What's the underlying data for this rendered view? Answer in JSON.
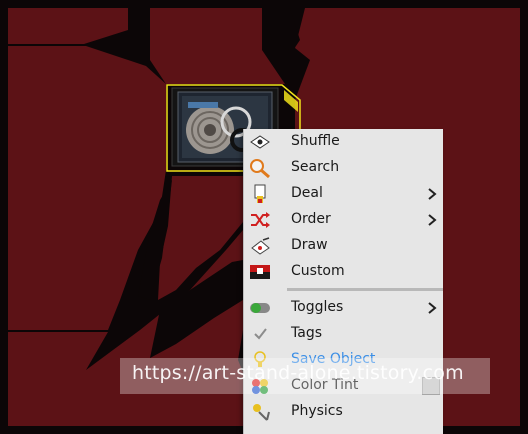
{
  "context_menu": {
    "items": [
      {
        "label": "Shuffle",
        "icon": "shuffle-card-icon",
        "has_submenu": false
      },
      {
        "label": "Search",
        "icon": "magnifier-icon",
        "has_submenu": false
      },
      {
        "label": "Deal",
        "icon": "deal-hand-icon",
        "has_submenu": true
      },
      {
        "label": "Order",
        "icon": "shuffle-arrows-icon",
        "has_submenu": true
      },
      {
        "label": "Draw",
        "icon": "draw-card-icon",
        "has_submenu": false
      },
      {
        "label": "Custom",
        "icon": "custom-card-icon",
        "has_submenu": false
      },
      {
        "label": "Toggles",
        "icon": "toggle-switch-icon",
        "has_submenu": true
      },
      {
        "label": "Tags",
        "icon": "checkmark-icon",
        "has_submenu": false
      },
      {
        "label": "Save Object",
        "icon": "lightbulb-icon",
        "has_submenu": false,
        "highlighted": true
      },
      {
        "label": "Color Tint",
        "icon": "color-palette-icon",
        "has_submenu": false,
        "swatch_color": "#c4c4c4"
      },
      {
        "label": "Physics",
        "icon": "physics-icon",
        "has_submenu": false
      }
    ],
    "highlight_color": "#3a8ee6"
  },
  "watermark": {
    "text": "https://art-stand-alone.tistory.com"
  },
  "colors": {
    "background_red": "#5c1216",
    "background_black": "#0c0607",
    "selection_outline": "#f2e21a",
    "menu_bg": "#e6e6e6"
  }
}
